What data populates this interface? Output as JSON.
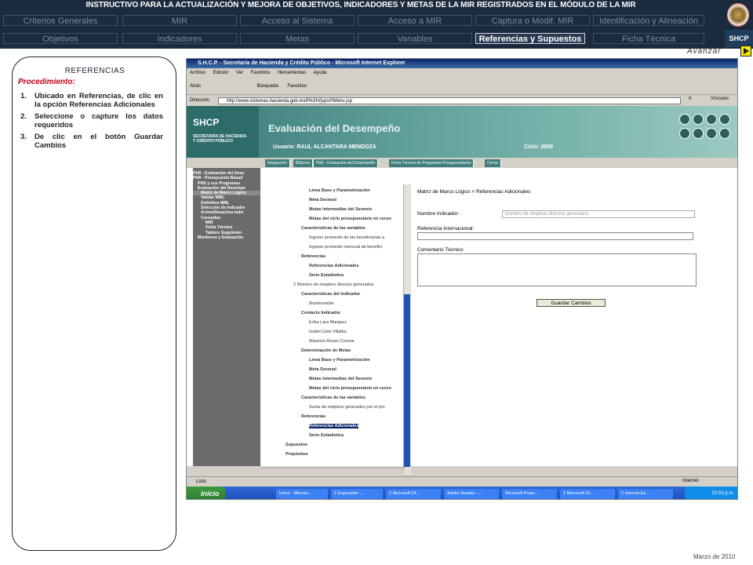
{
  "header": {
    "title": "INSTRUCTIVO PARA  LA ACTUALIZACIÓN Y MEJORA DE OBJETIVOS, INDICADORES Y METAS DE LA MIR REGISTRADOS EN EL MÓDULO DE LA MIR",
    "tabs_row1": [
      "Criterios Generales",
      "MIR",
      "Acceso al Sistema",
      "Acceso a MIR",
      "Captura o Modif. MIR",
      "Identificación y Alineación"
    ],
    "tabs_row2": [
      "Objetivos",
      "Indicadores",
      "Metas",
      "Variables",
      "Referencias y Supuestos",
      "Ficha Técnica"
    ],
    "active_tab": "Referencias y Supuestos",
    "logo_text": "SHCP",
    "advance_label": "Avanzar"
  },
  "panel": {
    "title": "REFERENCIAS",
    "procedure_label": "Procedimiento:",
    "steps": [
      {
        "num": "1.",
        "text": "Ubicado en Referencias, de clic en la opción Referencias Adicionales"
      },
      {
        "num": "2.",
        "text": "Seleccione o capture los datos requeridos"
      },
      {
        "num": "3.",
        "text": "De clic en el botón Guardar Cambios"
      }
    ]
  },
  "footer": {
    "date": "Marzo de 2010"
  },
  "screenshot": {
    "window_title": "S.H.C.P. - Secretaría de Hacienda y Crédito Público - Microsoft Internet Explorer",
    "menu": [
      "Archivo",
      "Edición",
      "Ver",
      "Favoritos",
      "Herramientas",
      "Ayuda"
    ],
    "toolbar": [
      "Atrás",
      "Búsqueda",
      "Favoritos"
    ],
    "address_label": "Dirección",
    "address": "http://www.sistemas.hacienda.gob.mx/PASH/jsps/frMenu.jsp",
    "go_label": "Ir",
    "links_label": "Vínculos",
    "site_logo": "SHCP",
    "site_sec": "SECRETARÍA DE HACIENDA Y CRÉDITO PÚBLICO",
    "site_title": "Evaluación del Desempeño",
    "user": "Usuario: RAUL ALCANTARA MENDOZA",
    "ciclo": "Ciclo: 2009",
    "site_tabs": [
      "Integración",
      "Bitácora",
      "PbR - Evaluación del Desempeño",
      "Ficha Técnica de Programas Presupuestarios",
      "Cerrar"
    ],
    "side_menu": [
      "PbR - Evaluación del Dese",
      "PbR - Presupuesto Basad",
      "PND y sus Programas",
      "Evaluación del Desempe",
      "Matriz de Marco Lógico",
      "Validar MML",
      "Definitiva MML",
      "Selección de Indicador",
      "Activa/Desactiva Indic",
      "Consultas",
      "MIR",
      "Ficha Técnica",
      "Tablero Seguimien",
      "Monitoreo y Evaluación"
    ],
    "tree": [
      "Línea Base y Parametrización",
      "Meta Sexenal",
      "Metas Intermedias del Sexenio",
      "Metas del ciclo presupuestario en curso",
      "Características de las variables",
      "Ingreso promedio de las beneficiarias a",
      "Ingreso promedio mensual de benefici",
      "Referencias",
      "Referencias Adicionales",
      "Serie Estadística",
      "2 Número de empleos directos generados.",
      "Características del Indicador",
      "Monitoreable",
      "Contacto Indicador",
      "Erika Lara Marquez",
      "Isabel Celis Villalba",
      "Mauricio Reyes Corona",
      "Determinación de Metas",
      "Línea Base y Parametrización",
      "Meta Sexenal",
      "Metas Intermedias del Sexenio",
      "Metas del ciclo presupuestario en curso",
      "Características de las variables",
      "Suma de empleos generados por el pro",
      "Referencias",
      "Referencias Adicionales",
      "Serie Estadística",
      "Supuestos",
      "Propósitos"
    ],
    "form": {
      "breadcrumb": "Matriz de Marco Lógico > Referencias Adicionales",
      "nombre_label": "Nombre Indicador:",
      "nombre_value": "Número de empleos directos generados.",
      "ref_label": "Referencia Internacional:",
      "comentario_label": "Comentario Técnico:",
      "save_label": "Guardar Cambios"
    },
    "status": "Listo",
    "zone": "Internet",
    "taskbar": {
      "start": "Inicio",
      "items": [
        "Inbox - Microso...",
        "2 Explorador ...",
        "2 Microsoft Of...",
        "Adobe Reader -...",
        "Microsoft Powe...",
        "2 Microsoft Of...",
        "2 Internet Ex..."
      ],
      "clock": "02:53 p.m."
    }
  }
}
